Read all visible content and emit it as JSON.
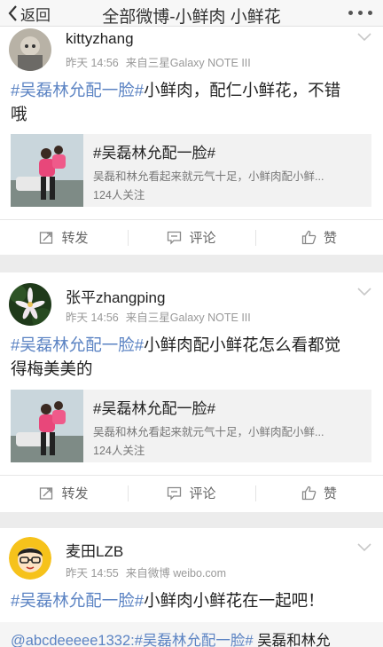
{
  "nav": {
    "back_label": "返回",
    "title": "全部微博-小鲜肉 小鲜花"
  },
  "posts": [
    {
      "username": "kittyzhang",
      "time": "昨天 14:56",
      "source": "来自三星Galaxy NOTE III",
      "topic": "#吴磊林允配一脸#",
      "text_line1_rest": "小鲜肉，配仁小鲜花，不错",
      "text_line2": "哦",
      "embed": {
        "title": "#吴磊林允配一脸#",
        "desc": "吴磊和林允看起来就元气十足，小鲜肉配小鲜...",
        "followers": "124人关注"
      },
      "actions": {
        "repost": "转发",
        "comment": "评论",
        "like": "赞"
      }
    },
    {
      "username": "张平zhangping",
      "time": "昨天 14:56",
      "source": "来自三星Galaxy NOTE III",
      "topic": "#吴磊林允配一脸#",
      "text_line1_rest": "小鲜肉配小鲜花怎么看都觉",
      "text_line2": "得梅美美的",
      "embed": {
        "title": "#吴磊林允配一脸#",
        "desc": "吴磊和林允看起来就元气十足，小鲜肉配小鲜...",
        "followers": "124人关注"
      },
      "actions": {
        "repost": "转发",
        "comment": "评论",
        "like": "赞"
      }
    },
    {
      "username": "麦田LZB",
      "time": "昨天 14:55",
      "source": "来自微博 weibo.com",
      "topic": "#吴磊林允配一脸#",
      "text_line1_rest": "小鲜肉小鲜花在一起吧！",
      "repost": {
        "mention": "@abcdeeeee1332:",
        "topic": "#吴磊林允配一脸#",
        "rest": " 吴磊和林允"
      }
    }
  ],
  "colors": {
    "link": "#5b83c3",
    "meta": "#999999",
    "background": "#f2f2f2"
  }
}
